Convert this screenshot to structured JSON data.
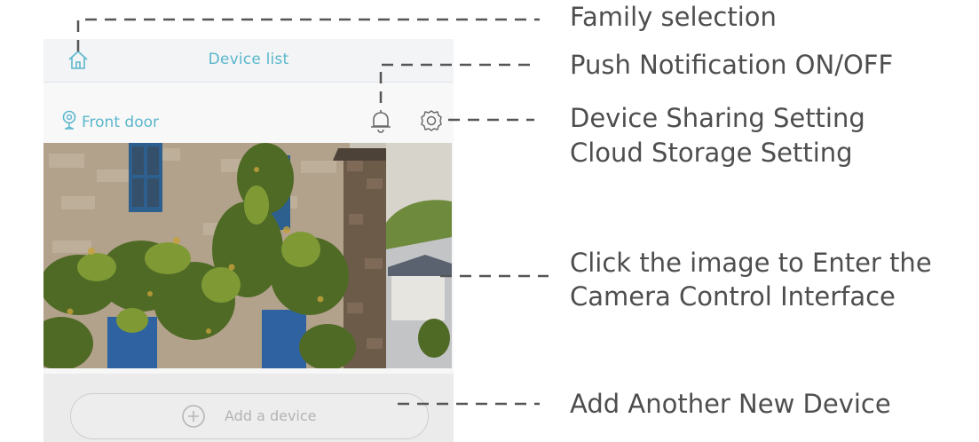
{
  "app": {
    "topbar_title": "Device list",
    "device_name": "Front door",
    "add_button_label": "Add a device"
  },
  "icons": {
    "home": "home-icon",
    "camera": "camera-icon",
    "bell": "bell-icon",
    "settings": "gear-icon",
    "add": "plus-circle-icon"
  },
  "callouts": {
    "family": "Family selection",
    "push": "Push Notification ON/OFF",
    "sharing_line1": "Device Sharing Setting",
    "sharing_line2": "Cloud Storage Setting",
    "image_line1": "Click the image to Enter the",
    "image_line2": "Camera Control Interface",
    "add": "Add Another New Device"
  },
  "colors": {
    "accent": "#5bb7cc",
    "callout_text": "#4e4e4e",
    "leader_line": "#555555"
  }
}
